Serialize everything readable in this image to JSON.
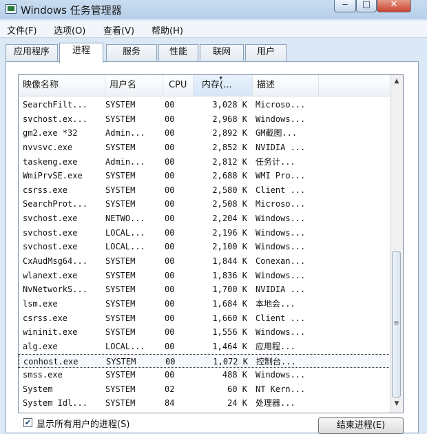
{
  "window": {
    "title": "Windows 任务管理器"
  },
  "menu": [
    "文件(F)",
    "选项(O)",
    "查看(V)",
    "帮助(H)"
  ],
  "tabs": [
    "应用程序",
    "进程",
    "服务",
    "性能",
    "联网",
    "用户"
  ],
  "active_tab": "进程",
  "columns": [
    "映像名称",
    "用户名",
    "CPU",
    "内存(...",
    "描述"
  ],
  "processes": [
    {
      "name": "SearchFilt...",
      "user": "SYSTEM",
      "cpu": "00",
      "mem": "3,028 K",
      "desc": "Microso..."
    },
    {
      "name": "svchost.ex...",
      "user": "SYSTEM",
      "cpu": "00",
      "mem": "2,968 K",
      "desc": "Windows..."
    },
    {
      "name": "gm2.exe *32",
      "user": "Admin...",
      "cpu": "00",
      "mem": "2,892 K",
      "desc": "GM截图..."
    },
    {
      "name": "nvvsvc.exe",
      "user": "SYSTEM",
      "cpu": "00",
      "mem": "2,852 K",
      "desc": "NVIDIA ..."
    },
    {
      "name": "taskeng.exe",
      "user": "Admin...",
      "cpu": "00",
      "mem": "2,812 K",
      "desc": "任务计..."
    },
    {
      "name": "WmiPrvSE.exe",
      "user": "SYSTEM",
      "cpu": "00",
      "mem": "2,688 K",
      "desc": "WMI Pro..."
    },
    {
      "name": "csrss.exe",
      "user": "SYSTEM",
      "cpu": "00",
      "mem": "2,580 K",
      "desc": "Client ..."
    },
    {
      "name": "SearchProt...",
      "user": "SYSTEM",
      "cpu": "00",
      "mem": "2,508 K",
      "desc": "Microso..."
    },
    {
      "name": "svchost.exe",
      "user": "NETWO...",
      "cpu": "00",
      "mem": "2,204 K",
      "desc": "Windows..."
    },
    {
      "name": "svchost.exe",
      "user": "LOCAL...",
      "cpu": "00",
      "mem": "2,196 K",
      "desc": "Windows..."
    },
    {
      "name": "svchost.exe",
      "user": "LOCAL...",
      "cpu": "00",
      "mem": "2,100 K",
      "desc": "Windows..."
    },
    {
      "name": "CxAudMsg64...",
      "user": "SYSTEM",
      "cpu": "00",
      "mem": "1,844 K",
      "desc": "Conexan..."
    },
    {
      "name": "wlanext.exe",
      "user": "SYSTEM",
      "cpu": "00",
      "mem": "1,836 K",
      "desc": "Windows..."
    },
    {
      "name": "NvNetworkS...",
      "user": "SYSTEM",
      "cpu": "00",
      "mem": "1,700 K",
      "desc": "NVIDIA ..."
    },
    {
      "name": "lsm.exe",
      "user": "SYSTEM",
      "cpu": "00",
      "mem": "1,684 K",
      "desc": "本地会..."
    },
    {
      "name": "csrss.exe",
      "user": "SYSTEM",
      "cpu": "00",
      "mem": "1,660 K",
      "desc": "Client ..."
    },
    {
      "name": "wininit.exe",
      "user": "SYSTEM",
      "cpu": "00",
      "mem": "1,556 K",
      "desc": "Windows..."
    },
    {
      "name": "alg.exe",
      "user": "LOCAL...",
      "cpu": "00",
      "mem": "1,464 K",
      "desc": "应用程..."
    },
    {
      "name": "conhost.exe",
      "user": "SYSTEM",
      "cpu": "00",
      "mem": "1,072 K",
      "desc": "控制台..."
    },
    {
      "name": "smss.exe",
      "user": "SYSTEM",
      "cpu": "00",
      "mem": "488 K",
      "desc": "Windows..."
    },
    {
      "name": "System",
      "user": "SYSTEM",
      "cpu": "02",
      "mem": "60 K",
      "desc": "NT Kern..."
    },
    {
      "name": "System Idl...",
      "user": "SYSTEM",
      "cpu": "84",
      "mem": "24 K",
      "desc": "处理器..."
    }
  ],
  "selected_process": "conhost.exe",
  "show_all_users": {
    "label": "显示所有用户的进程(S)",
    "checked": true
  },
  "end_process_button": "结束进程(E)",
  "icons": {
    "app": "task-manager-icon",
    "minimize": "minimize-icon",
    "maximize": "maximize-icon",
    "close": "close-icon",
    "sort": "sort-descending-icon"
  }
}
